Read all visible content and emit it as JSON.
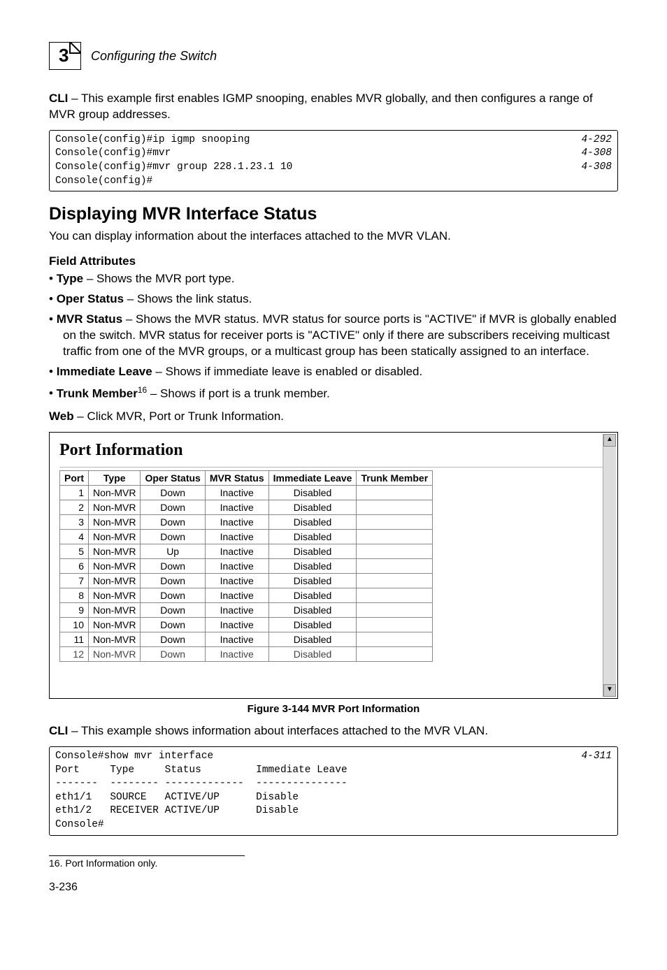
{
  "header": {
    "chapter_number": "3",
    "running_title": "Configuring the Switch"
  },
  "intro_cli": {
    "label": "CLI",
    "text_after_label": " – This example first enables IGMP snooping, enables MVR globally, and then configures a range of MVR group addresses."
  },
  "code1": {
    "lines": [
      {
        "cmd": "Console(config)#ip igmp snooping",
        "ref": "4-292"
      },
      {
        "cmd": "Console(config)#mvr",
        "ref": "4-308"
      },
      {
        "cmd": "Console(config)#mvr group 228.1.23.1 10",
        "ref": "4-308"
      },
      {
        "cmd": "Console(config)#",
        "ref": ""
      }
    ]
  },
  "section_title": "Displaying MVR Interface Status",
  "section_intro": "You can display information about the interfaces attached to the MVR VLAN.",
  "field_attributes_title": "Field Attributes",
  "bullets": [
    {
      "term": "Type",
      "desc": " – Shows the MVR port type."
    },
    {
      "term": "Oper Status",
      "desc": " – Shows the link status."
    },
    {
      "term": "MVR Status",
      "desc": " – Shows the MVR status. MVR status for source ports is \"ACTIVE\" if MVR is globally enabled on the switch. MVR status for receiver ports is \"ACTIVE\" only if there are subscribers receiving multicast traffic from one of the MVR groups, or a multicast group has been statically assigned to an interface."
    },
    {
      "term": "Immediate Leave",
      "desc": " – Shows if immediate leave is enabled or disabled."
    },
    {
      "term": "Trunk Member",
      "sup": "16",
      "desc": " – Shows if port is a trunk member."
    }
  ],
  "web_line": {
    "label": "Web",
    "text": " – Click MVR, Port or Trunk Information."
  },
  "screenshot": {
    "title": "Port Information",
    "columns": [
      "Port",
      "Type",
      "Oper Status",
      "MVR Status",
      "Immediate Leave",
      "Trunk Member"
    ],
    "rows": [
      [
        "1",
        "Non-MVR",
        "Down",
        "Inactive",
        "Disabled",
        ""
      ],
      [
        "2",
        "Non-MVR",
        "Down",
        "Inactive",
        "Disabled",
        ""
      ],
      [
        "3",
        "Non-MVR",
        "Down",
        "Inactive",
        "Disabled",
        ""
      ],
      [
        "4",
        "Non-MVR",
        "Down",
        "Inactive",
        "Disabled",
        ""
      ],
      [
        "5",
        "Non-MVR",
        "Up",
        "Inactive",
        "Disabled",
        ""
      ],
      [
        "6",
        "Non-MVR",
        "Down",
        "Inactive",
        "Disabled",
        ""
      ],
      [
        "7",
        "Non-MVR",
        "Down",
        "Inactive",
        "Disabled",
        ""
      ],
      [
        "8",
        "Non-MVR",
        "Down",
        "Inactive",
        "Disabled",
        ""
      ],
      [
        "9",
        "Non-MVR",
        "Down",
        "Inactive",
        "Disabled",
        ""
      ],
      [
        "10",
        "Non-MVR",
        "Down",
        "Inactive",
        "Disabled",
        ""
      ],
      [
        "11",
        "Non-MVR",
        "Down",
        "Inactive",
        "Disabled",
        ""
      ]
    ],
    "cut_row": [
      "12",
      "Non-MVR",
      "Down",
      "Inactive",
      "Disabled",
      ""
    ]
  },
  "figure_caption": "Figure 3-144  MVR Port Information",
  "cli2_intro": {
    "label": "CLI",
    "text": " – This example shows information about interfaces attached to the MVR VLAN."
  },
  "code2": {
    "header_cmd": "Console#show mvr interface",
    "header_ref": "4-311",
    "cols_line": "Port     Type     Status         Immediate Leave",
    "dash_line": "-------  -------- -------------  ---------------",
    "rows": [
      "eth1/1   SOURCE   ACTIVE/UP      Disable",
      "eth1/2   RECEIVER ACTIVE/UP      Disable"
    ],
    "prompt": "Console#"
  },
  "footnote": "16. Port Information only.",
  "page_number": "3-236"
}
